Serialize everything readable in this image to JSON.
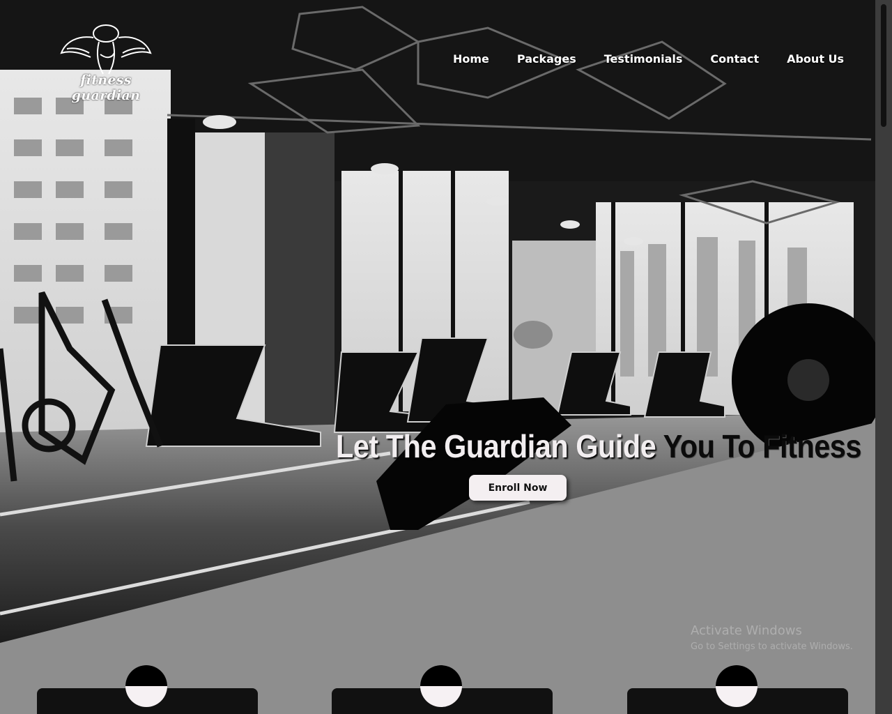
{
  "brand": {
    "logo_text": "fitness guardian",
    "logo_icon": "angel-athlete-logo-icon"
  },
  "nav": {
    "items": [
      {
        "label": "Home"
      },
      {
        "label": "Packages"
      },
      {
        "label": "Testimonials"
      },
      {
        "label": "Contact"
      },
      {
        "label": "About Us"
      }
    ]
  },
  "hero": {
    "headline_light": "Let The Guardian Guide",
    "headline_dark": "You To Fitness",
    "cta_label": "Enroll Now"
  },
  "watermark": {
    "title": "Activate Windows",
    "subtitle": "Go to Settings to activate Windows."
  },
  "cards": [
    {
      "icon": "circle-icon"
    },
    {
      "icon": "circle-icon"
    },
    {
      "icon": "circle-icon"
    }
  ],
  "colors": {
    "lower_background": "#8e8e8e",
    "card": "#111111",
    "cta_background": "#f4eff1",
    "nav_text": "#ffffff"
  }
}
